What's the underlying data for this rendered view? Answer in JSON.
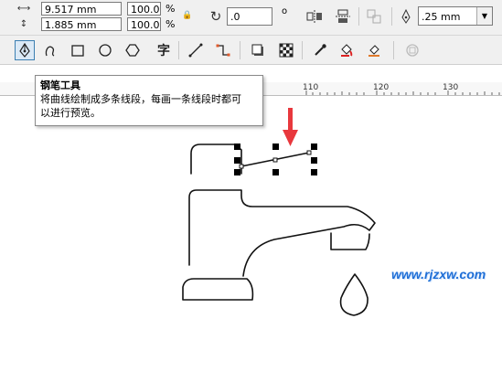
{
  "property_bar": {
    "width_value": "9.517 mm",
    "height_value": "1.885 mm",
    "scale_x": "100.0",
    "scale_y": "100.0",
    "percent": "%",
    "rotation_value": ".0",
    "degree_symbol": "o",
    "outline_width": ".25 mm"
  },
  "ruler": {
    "ticks": [
      "110",
      "120",
      "130"
    ]
  },
  "tooltip": {
    "title": "钢笔工具",
    "description_line1": "将曲线绘制成多条线段，每画一条线段时都可",
    "description_line2": "以进行预览。"
  },
  "watermark": "www.rjzxw.com",
  "toolbar": {
    "text_tool_glyph": "字"
  },
  "colors": {
    "accent_arrow": "#e8383d",
    "watermark": "#1f6fd6",
    "tool_active_border": "#3c7fb1"
  }
}
